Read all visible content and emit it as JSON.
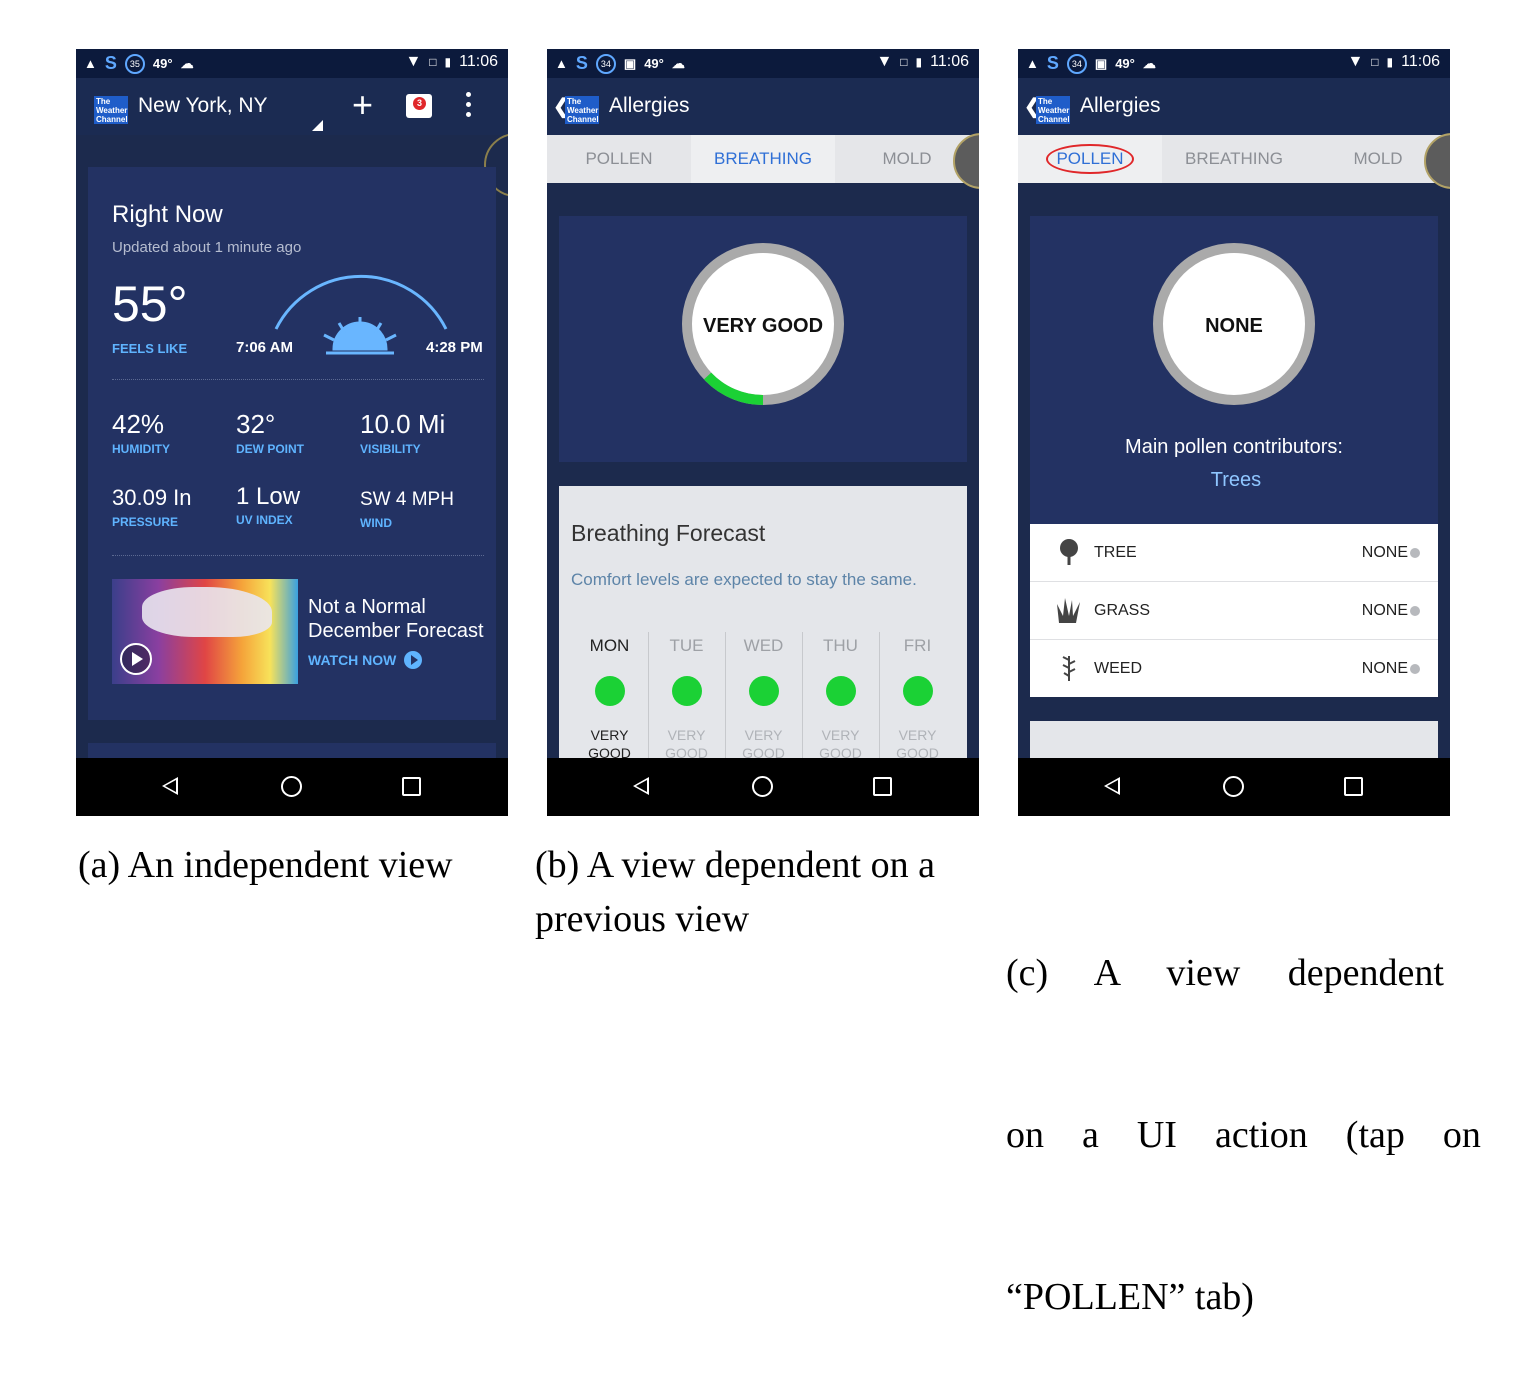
{
  "status_bar": {
    "time": "11:06",
    "temp_a": "49°",
    "badge_a": "35",
    "badge_b": "34",
    "badge_c": "34"
  },
  "logo": {
    "line1": "The",
    "line2": "Weather",
    "line3": "Channel"
  },
  "screen_a": {
    "title": "New York, NY",
    "gift_count": "3",
    "right_now": {
      "heading": "Right Now",
      "updated": "Updated about 1 minute ago",
      "temperature": "55°",
      "feels_like": "FEELS LIKE",
      "sunrise": "7:06 AM",
      "sunset": "4:28 PM",
      "stats": [
        {
          "value": "42%",
          "label": "HUMIDITY"
        },
        {
          "value": "32°",
          "label": "DEW POINT"
        },
        {
          "value": "10.0 Mi",
          "label": "VISIBILITY"
        },
        {
          "value": "30.09 In",
          "label": "PRESSURE"
        },
        {
          "value": "1 Low",
          "label": "UV INDEX"
        },
        {
          "value": "SW 4 MPH",
          "label": "WIND"
        }
      ],
      "video": {
        "line1": "Not a Normal",
        "line2": "December Forecast",
        "cta": "WATCH NOW"
      }
    }
  },
  "screen_b": {
    "title": "Allergies",
    "tabs": [
      "POLLEN",
      "BREATHING",
      "MOLD"
    ],
    "active_tab": "BREATHING",
    "gauge_label": "VERY GOOD",
    "gauge_fill": 0.13,
    "forecast": {
      "title": "Breathing Forecast",
      "description": "Comfort levels are expected to stay the same.",
      "days": [
        {
          "name": "MON",
          "line1": "VERY",
          "line2": "GOOD"
        },
        {
          "name": "TUE",
          "line1": "VERY",
          "line2": "GOOD"
        },
        {
          "name": "WED",
          "line1": "VERY",
          "line2": "GOOD"
        },
        {
          "name": "THU",
          "line1": "VERY",
          "line2": "GOOD"
        },
        {
          "name": "FRI",
          "line1": "VERY",
          "line2": "GOOD"
        }
      ]
    }
  },
  "screen_c": {
    "title": "Allergies",
    "tabs": [
      "POLLEN",
      "BREATHING",
      "MOLD"
    ],
    "active_tab": "POLLEN",
    "gauge_label": "NONE",
    "contributors_heading": "Main pollen contributors:",
    "contributors_value": "Trees",
    "pollen_types": [
      {
        "label": "TREE",
        "value": "NONE",
        "icon": "tree-icon"
      },
      {
        "label": "GRASS",
        "value": "NONE",
        "icon": "grass-icon"
      },
      {
        "label": "WEED",
        "value": "NONE",
        "icon": "weed-icon"
      }
    ]
  },
  "captions": {
    "a": "(a)  An independent view",
    "b_line1": "(b)  A view dependent on a",
    "b_line2": "previous view",
    "c_line1": "(c)     A     view     dependent",
    "c_line2": "on    a    UI    action    (tap    on",
    "c_line3": "“POLLEN” tab)"
  },
  "colors": {
    "accent_blue": "#2f6fd6",
    "status_green": "#1bd135",
    "highlight_red": "#e0272a",
    "label_blue": "#5fb4ff"
  }
}
